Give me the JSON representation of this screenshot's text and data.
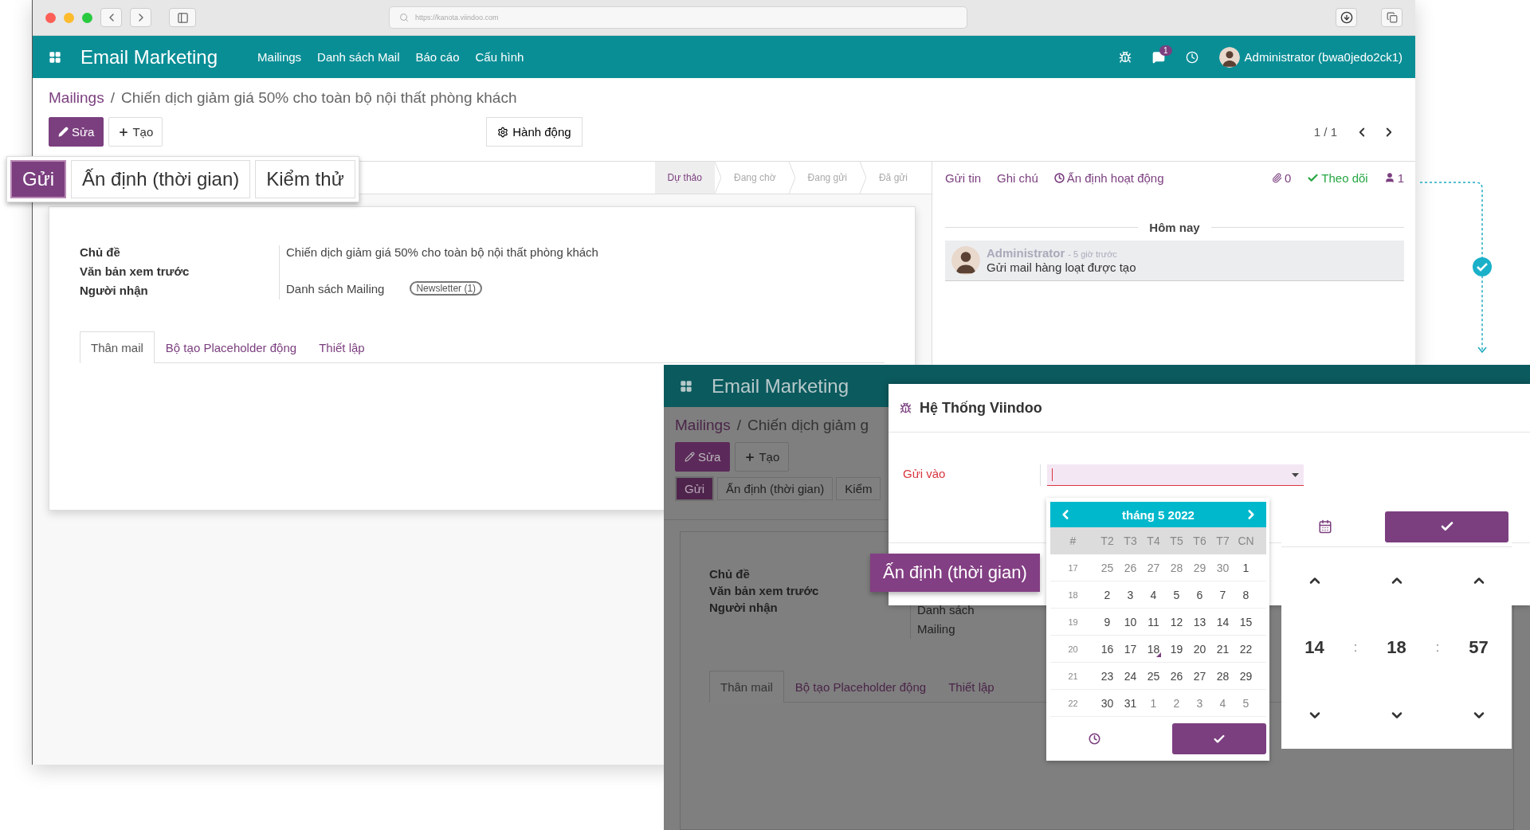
{
  "browser": {
    "url": "https://kanota.viindoo.com"
  },
  "navbar": {
    "app": "Email Marketing",
    "menu": [
      "Mailings",
      "Danh sách Mail",
      "Báo cáo",
      "Cấu hình"
    ],
    "messages_badge": "1",
    "user": "Administrator (bwa0jedo2ck1)"
  },
  "breadcrumb": [
    "Mailings",
    "/",
    "Chiến dịch giảm giá 50% cho toàn bộ nội thất phòng khách"
  ],
  "buttons": [
    {
      "label": "Sửa",
      "kind": "edit"
    },
    {
      "label": "Tạo",
      "kind": "create"
    }
  ],
  "action": "Hành động",
  "pager": "1 / 1",
  "header_buttons": [
    {
      "label": "Gửi",
      "kind": "primary"
    },
    {
      "label": "Ấn định (thời gian)",
      "kind": "secondary"
    },
    {
      "label": "Kiểm thử",
      "kind": "secondary"
    }
  ],
  "stages": [
    {
      "label": "Dự thảo",
      "selected": true
    },
    {
      "label": "Đang chờ",
      "selected": false
    },
    {
      "label": "Đang gửi",
      "selected": false
    },
    {
      "label": "Đã gửi",
      "selected": false
    }
  ],
  "fields": [
    {
      "label": "Chủ đề",
      "value": "Chiến dịch giảm giá 50% cho toàn bộ nội thất phòng khách"
    },
    {
      "label": "Văn bản xem trước"
    },
    {
      "label": "Người nhận",
      "value": "Danh sách Mailing",
      "tag": "Newsletter (1)"
    }
  ],
  "tabs": [
    {
      "label": "Thân mail",
      "selected": true
    },
    {
      "label": "Bộ tạo Placeholder động",
      "selected": false
    },
    {
      "label": "Thiết lập",
      "selected": false
    }
  ],
  "chatter": {
    "actions": [
      "Gửi tin",
      "Ghi chú",
      "Ấn định hoạt động"
    ],
    "attachments": "0",
    "follow": "Theo dõi",
    "followers": "1",
    "date_separator": "Hôm nay",
    "message": {
      "author": "Administrator",
      "time": "- 5 giờ trước",
      "body": "Gửi mail hàng loạt được tạo"
    }
  },
  "background_screen": {
    "app": "Email Marketing",
    "breadcrumb": [
      "Mailings",
      "/",
      "Chiến dịch giảm g"
    ],
    "buttons": [
      {
        "label": "Sửa",
        "kind": "edit"
      },
      {
        "label": "Tạo",
        "kind": "create"
      }
    ],
    "header_buttons": [
      {
        "label": "Gửi",
        "kind": "primary"
      },
      {
        "label": "Ấn định (thời gian)",
        "kind": "secondary"
      },
      {
        "label": "Kiểm",
        "kind": "secondary"
      }
    ],
    "fields": [
      {
        "label": "Chủ đề"
      },
      {
        "label": "Văn bản xem trước"
      },
      {
        "label": "Người nhận",
        "value": "Danh sách Mailing"
      }
    ],
    "tabs": [
      {
        "label": "Thân mail",
        "selected": true
      },
      {
        "label": "Bộ tạo Placeholder động",
        "selected": false
      },
      {
        "label": "Thiết lập",
        "selected": false
      }
    ]
  },
  "dialog": {
    "title": "Hệ Thống Viindoo",
    "field_label": "Gửi vào"
  },
  "calendar": {
    "month": "tháng 5 2022",
    "headers": [
      "#",
      "T2",
      "T3",
      "T4",
      "T5",
      "T6",
      "T7",
      "CN"
    ],
    "weeks": [
      {
        "week": "17",
        "days": [
          {
            "label": "25",
            "muted": true,
            "today": false
          },
          {
            "label": "26",
            "muted": true,
            "today": false
          },
          {
            "label": "27",
            "muted": true,
            "today": false
          },
          {
            "label": "28",
            "muted": true,
            "today": false
          },
          {
            "label": "29",
            "muted": true,
            "today": false
          },
          {
            "label": "30",
            "muted": true,
            "today": false
          },
          {
            "label": "1",
            "muted": false,
            "today": false
          }
        ]
      },
      {
        "week": "18",
        "days": [
          {
            "label": "2",
            "muted": false,
            "today": false
          },
          {
            "label": "3",
            "muted": false,
            "today": false
          },
          {
            "label": "4",
            "muted": false,
            "today": false
          },
          {
            "label": "5",
            "muted": false,
            "today": false
          },
          {
            "label": "6",
            "muted": false,
            "today": false
          },
          {
            "label": "7",
            "muted": false,
            "today": false
          },
          {
            "label": "8",
            "muted": false,
            "today": false
          }
        ]
      },
      {
        "week": "19",
        "days": [
          {
            "label": "9",
            "muted": false,
            "today": false
          },
          {
            "label": "10",
            "muted": false,
            "today": false
          },
          {
            "label": "11",
            "muted": false,
            "today": false
          },
          {
            "label": "12",
            "muted": false,
            "today": false
          },
          {
            "label": "13",
            "muted": false,
            "today": false
          },
          {
            "label": "14",
            "muted": false,
            "today": false
          },
          {
            "label": "15",
            "muted": false,
            "today": false
          }
        ]
      },
      {
        "week": "20",
        "days": [
          {
            "label": "16",
            "muted": false,
            "today": false
          },
          {
            "label": "17",
            "muted": false,
            "today": false
          },
          {
            "label": "18",
            "muted": false,
            "today": true
          },
          {
            "label": "19",
            "muted": false,
            "today": false
          },
          {
            "label": "20",
            "muted": false,
            "today": false
          },
          {
            "label": "21",
            "muted": false,
            "today": false
          },
          {
            "label": "22",
            "muted": false,
            "today": false
          }
        ]
      },
      {
        "week": "21",
        "days": [
          {
            "label": "23",
            "muted": false,
            "today": false
          },
          {
            "label": "24",
            "muted": false,
            "today": false
          },
          {
            "label": "25",
            "muted": false,
            "today": false
          },
          {
            "label": "26",
            "muted": false,
            "today": false
          },
          {
            "label": "27",
            "muted": false,
            "today": false
          },
          {
            "label": "28",
            "muted": false,
            "today": false
          },
          {
            "label": "29",
            "muted": false,
            "today": false
          }
        ]
      },
      {
        "week": "22",
        "days": [
          {
            "label": "30",
            "muted": false,
            "today": false
          },
          {
            "label": "31",
            "muted": false,
            "today": false
          },
          {
            "label": "1",
            "muted": true,
            "today": false
          },
          {
            "label": "2",
            "muted": true,
            "today": false
          },
          {
            "label": "3",
            "muted": true,
            "today": false
          },
          {
            "label": "4",
            "muted": true,
            "today": false
          },
          {
            "label": "5",
            "muted": true,
            "today": false
          }
        ]
      }
    ]
  },
  "time": {
    "hours": "14",
    "minutes": "18",
    "seconds": "57",
    "separators": [
      ":",
      ":"
    ]
  },
  "callout": "Ấn định (thời gian)"
}
